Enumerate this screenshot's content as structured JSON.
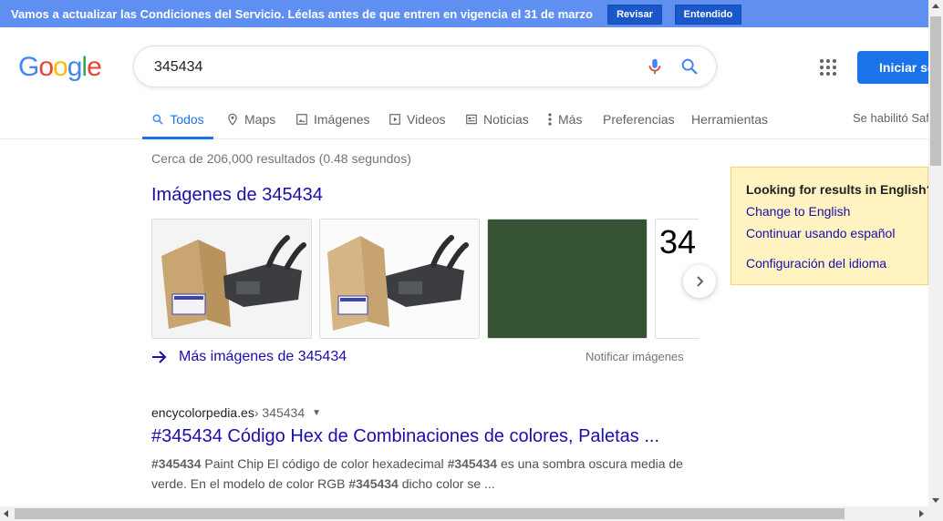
{
  "banner": {
    "message": "Vamos a actualizar las Condiciones del Servicio. Léelas antes de que entren en vigencia el 31 de marzo",
    "review_label": "Revisar",
    "ok_label": "Entendido",
    "background_color": "#5f8ff0"
  },
  "header": {
    "logo_letters": [
      "G",
      "o",
      "o",
      "g",
      "l",
      "e"
    ],
    "logo_colors": [
      "#4285f4",
      "#ea4335",
      "#fbbc05",
      "#4285f4",
      "#34a853",
      "#ea4335"
    ],
    "search_value": "345434",
    "signin_label": "Iniciar sesión",
    "mic_icon": "mic-icon",
    "search_icon": "search-icon",
    "apps_icon": "apps-grid-icon"
  },
  "tabs": {
    "all": "Todos",
    "maps": "Maps",
    "images": "Imágenes",
    "videos": "Videos",
    "news": "Noticias",
    "more": "Más",
    "preferences": "Preferencias",
    "tools": "Herramientas",
    "safesearch": "Se habilitó SafeSearch"
  },
  "results": {
    "stats": "Cerca de 206,000 resultados (0.48 segundos)",
    "images_title": "Imágenes de 345434",
    "thumb4_text": "34",
    "swatch_color": "#345434",
    "more_images": "Más imágenes de 345434",
    "report_images": "Notificar imágenes",
    "first": {
      "site": "encycolorpedia.es",
      "path": " › 345434",
      "title": "#345434 Código Hex de Combinaciones de colores, Paletas ...",
      "snippet_1_bold": "#345434",
      "snippet_1_text": " Paint Chip El código de color hexadecimal ",
      "snippet_2_bold": "#345434",
      "snippet_2_text": " es una sombra oscura media de verde. En el modelo de color RGB ",
      "snippet_3_bold": "#345434",
      "snippet_3_text": " dicho color se ..."
    }
  },
  "language_panel": {
    "question": "Looking for results in English?",
    "change": "Change to English",
    "keep": "Continuar usando español",
    "settings": "Configuración del idioma"
  }
}
